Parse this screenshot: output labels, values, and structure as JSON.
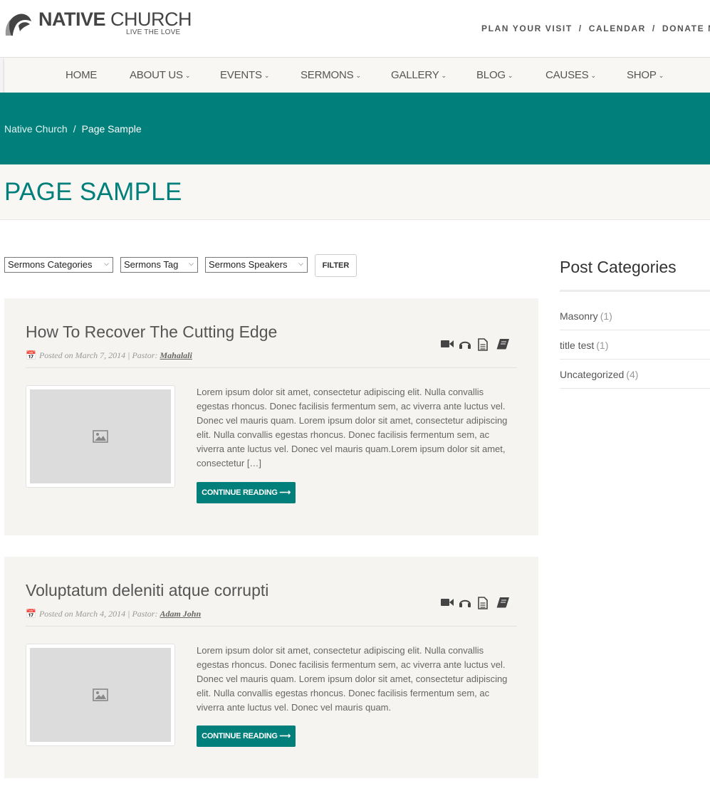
{
  "brand": {
    "name_bold": "NATIVE",
    "name_light": "CHURCH",
    "tagline": "LIVE THE LOVE",
    "accent": "#007f7b"
  },
  "toplinks": [
    "PLAN YOUR VISIT",
    "CALENDAR",
    "DONATE NOW"
  ],
  "toplinks_separator": "/",
  "nav": {
    "items": [
      {
        "label": "HOME",
        "dropdown": false
      },
      {
        "label": "ABOUT US",
        "dropdown": true
      },
      {
        "label": "EVENTS",
        "dropdown": true
      },
      {
        "label": "SERMONS",
        "dropdown": true
      },
      {
        "label": "GALLERY",
        "dropdown": true
      },
      {
        "label": "BLOG",
        "dropdown": true
      },
      {
        "label": "CAUSES",
        "dropdown": true
      },
      {
        "label": "SHOP",
        "dropdown": true
      }
    ]
  },
  "breadcrumb": {
    "home": "Native Church",
    "separator": "/",
    "current": "Page Sample"
  },
  "page_title": "PAGE SAMPLE",
  "filters": {
    "categories": "Sermons Categories",
    "tag": "Sermons Tag",
    "speakers": "Sermons Speakers",
    "button": "FILTER"
  },
  "posts": [
    {
      "title": "How To Recover The Cutting Edge",
      "meta_prefix": "Posted on March 7, 2014 | Pastor: ",
      "pastor": "Mahalali",
      "excerpt": "Lorem ipsum dolor sit amet, consectetur adipiscing elit. Nulla convallis egestas rhoncus. Donec facilisis fermentum sem, ac viverra ante luctus vel. Donec vel mauris quam. Lorem ipsum dolor sit amet, consectetur adipiscing elit. Nulla convallis egestas rhoncus. Donec facilisis fermentum sem, ac viverra ante luctus vel. Donec vel mauris quam.Lorem ipsum dolor sit amet, consectetur […]",
      "button": "CONTINUE READING ⟶"
    },
    {
      "title": "Voluptatum deleniti atque corrupti",
      "meta_prefix": "Posted on March 4, 2014 | Pastor: ",
      "pastor": "Adam John",
      "excerpt": "Lorem ipsum dolor sit amet, consectetur adipiscing elit. Nulla convallis egestas rhoncus. Donec facilisis fermentum sem, ac viverra ante luctus vel. Donec vel mauris quam. Lorem ipsum dolor sit amet, consectetur adipiscing elit. Nulla convallis egestas rhoncus. Donec facilisis fermentum sem, ac viverra ante luctus vel. Donec vel mauris quam.",
      "button": "CONTINUE READING ⟶"
    }
  ],
  "post_icons": [
    "video-icon",
    "headphones-icon",
    "document-icon",
    "book-icon"
  ],
  "sidebar": {
    "title": "Post Categories",
    "categories": [
      {
        "name": "Masonry",
        "count": "(1)"
      },
      {
        "name": "title test",
        "count": "(1)"
      },
      {
        "name": "Uncategorized",
        "count": "(4)"
      }
    ]
  }
}
